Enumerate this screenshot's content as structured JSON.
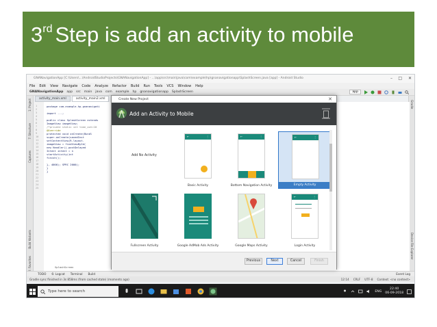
{
  "slide": {
    "title_number": "3",
    "title_sup": "rd",
    "title_rest": "Step is add an activity to mobile"
  },
  "ide": {
    "window_title": "GNANavigationApp [C:\\Users\\...\\AndroidStudioProjects\\GNANavigationApp] - ...\\app\\src\\main\\java\\com\\example\\hp\\gnanavigationapp\\SplashScreen.java [app] - Android Studio",
    "menu": [
      "File",
      "Edit",
      "View",
      "Navigate",
      "Code",
      "Analyze",
      "Refactor",
      "Build",
      "Run",
      "Tools",
      "VCS",
      "Window",
      "Help"
    ],
    "breadcrumb": [
      "GNANavigationApp",
      "app",
      "src",
      "main",
      "java",
      "com",
      "example",
      "hp",
      "gnanavigationapp",
      "SplashScreen"
    ],
    "run_config": "app",
    "editor_tabs": [
      "activity_main.xml",
      "activity_main2.xml"
    ],
    "left_tool_tabs": [
      "1: Project",
      "7: Structure",
      "Captures",
      "Build Variants",
      "2: Favorites"
    ],
    "right_tool_tabs": [
      "Gradle",
      "Device File Explorer"
    ],
    "code_lines": [
      "package com.example.hp.gnanavigati",
      "",
      "import ...;",
      "",
      "public class SplashScreen extends",
      "    ImageView imageView;",
      "    /*private static int time_out=10",
      "    @Override",
      "    protected void onCreate(Bundl",
      "        super.onCreate(savedInst",
      "        setContentView(R.layout.",
      "        imageView = findViewById(",
      "        new Handler().postDelayed",
      "            Intent intent = n",
      "            startActivity(int",
      "            finish();",
      "",
      "        }, 4000);   SPRC 2000);",
      "    }",
      "}"
    ],
    "line_numbers": [
      "1",
      "2",
      "3",
      "4",
      "5",
      "6",
      "7",
      "8",
      "9",
      "10",
      "11",
      "12",
      "13",
      "14",
      "15",
      "16",
      "17",
      "18",
      "19",
      "20",
      "21",
      "22",
      "23",
      "24",
      "25"
    ],
    "file_breadcrumb": "SplashScreen",
    "bottom_tabs": [
      "TODO",
      "6: Logcat",
      "Terminal",
      "Build"
    ],
    "event_log": "Event Log",
    "status_message": "Gradle sync finished in 3s 858ms (from cached state) (moments ago)",
    "status_right": [
      "12:14",
      "CRLF",
      "UTF-8",
      "Context: <no context>"
    ]
  },
  "dialog": {
    "window_title": "Create New Project",
    "header": "Add an Activity to Mobile",
    "cards": [
      {
        "label": "Add No Activity"
      },
      {
        "label": "Basic Activity"
      },
      {
        "label": "Bottom Navigation Activity"
      },
      {
        "label": "Empty Activity"
      },
      {
        "label": "Fullscreen Activity"
      },
      {
        "label": "Google AdMob Ads Activity"
      },
      {
        "label": "Google Maps Activity"
      },
      {
        "label": "Login Activity"
      }
    ],
    "selected": "Empty Activity",
    "buttons": {
      "previous": "Previous",
      "next": "Next",
      "cancel": "Cancel",
      "finish": "Finish"
    }
  },
  "taskbar": {
    "search_placeholder": "Type here to search",
    "language": "ENG",
    "time": "22:40",
    "date": "06-09-2018"
  },
  "colors": {
    "banner": "#5e8a3b",
    "accent_teal": "#1a8a7a",
    "selection": "#3c7ec6",
    "dark_header": "#3c3f41"
  }
}
